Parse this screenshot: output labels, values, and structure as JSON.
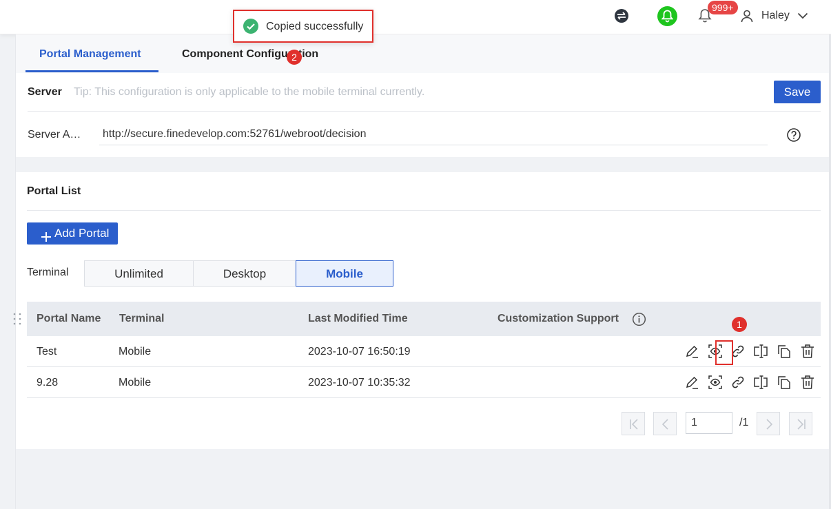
{
  "topbar": {
    "notification_badge": "999+",
    "username": "Haley",
    "icons": [
      "swap-icon",
      "green-bell-icon",
      "bell-icon",
      "user-icon",
      "chevron-down-icon"
    ]
  },
  "toast": {
    "message": "Copied successfully"
  },
  "tabs": [
    {
      "label": "Portal Management",
      "active": true
    },
    {
      "label": "Component Configuration",
      "active": false
    }
  ],
  "server": {
    "title": "Server",
    "tip": "Tip: This configuration is only applicable to the mobile terminal currently.",
    "save_label": "Save",
    "address_label": "Server A…",
    "address_value": "http://secure.finedevelop.com:52761/webroot/decision"
  },
  "portal_list": {
    "title": "Portal List",
    "add_label": "Add Portal",
    "terminal_label": "Terminal",
    "terminal_options": [
      "Unlimited",
      "Desktop",
      "Mobile"
    ],
    "terminal_selected": "Mobile",
    "columns": [
      "Portal Name",
      "Terminal",
      "Last Modified Time",
      "Customization Support"
    ],
    "rows": [
      {
        "name": "Test",
        "terminal": "Mobile",
        "modified": "2023-10-07 16:50:19"
      },
      {
        "name": "9.28",
        "terminal": "Mobile",
        "modified": "2023-10-07 10:35:32"
      }
    ],
    "row_actions": [
      "edit-icon",
      "preview-icon",
      "link-icon",
      "rename-icon",
      "copy-icon",
      "delete-icon"
    ]
  },
  "pagination": {
    "current_page": "1",
    "total": "/1"
  },
  "markers": [
    "1",
    "2"
  ],
  "colors": {
    "accent": "#2b5ecc",
    "highlight": "#e0302c",
    "success": "#3cb371",
    "badge": "#e64545"
  }
}
